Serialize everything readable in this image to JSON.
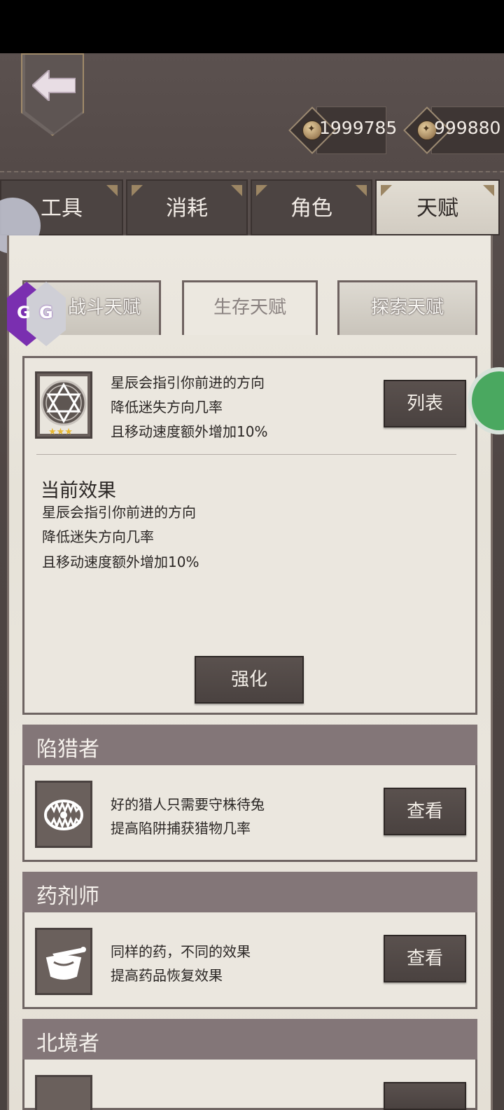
{
  "currency": [
    {
      "icon": "coin-icon",
      "value": "1999785"
    },
    {
      "icon": "token-icon",
      "value": "999880"
    }
  ],
  "tabs": [
    {
      "label": "工具",
      "active": false
    },
    {
      "label": "消耗",
      "active": false
    },
    {
      "label": "角色",
      "active": false
    },
    {
      "label": "天赋",
      "active": true
    }
  ],
  "subtabs": [
    {
      "label": "战斗天赋",
      "active": false
    },
    {
      "label": "生存天赋",
      "active": true
    },
    {
      "label": "探索天赋",
      "active": false
    }
  ],
  "current_talent": {
    "icon": "hexagram-icon",
    "stars": "★★★",
    "lines": [
      "星辰会指引你前进的方向",
      "降低迷失方向几率",
      "且移动速度额外增加10%"
    ],
    "list_button": "列表",
    "effect_title": "当前效果",
    "effect_lines": [
      "星辰会指引你前进的方向",
      "降低迷失方向几率",
      "且移动速度额外增加10%"
    ],
    "upgrade_button": "强化"
  },
  "sections": [
    {
      "title": "陷猎者",
      "icon": "bear-trap-icon",
      "lines": [
        "好的猎人只需要守株待兔",
        "提高陷阱捕获猎物几率"
      ],
      "button": "查看"
    },
    {
      "title": "药剂师",
      "icon": "mortar-icon",
      "lines": [
        "同样的药，不同的效果",
        "提高药品恢复效果"
      ],
      "button": "查看"
    },
    {
      "title": "北境者"
    }
  ],
  "overlay": {
    "gg_badge": "GG"
  }
}
